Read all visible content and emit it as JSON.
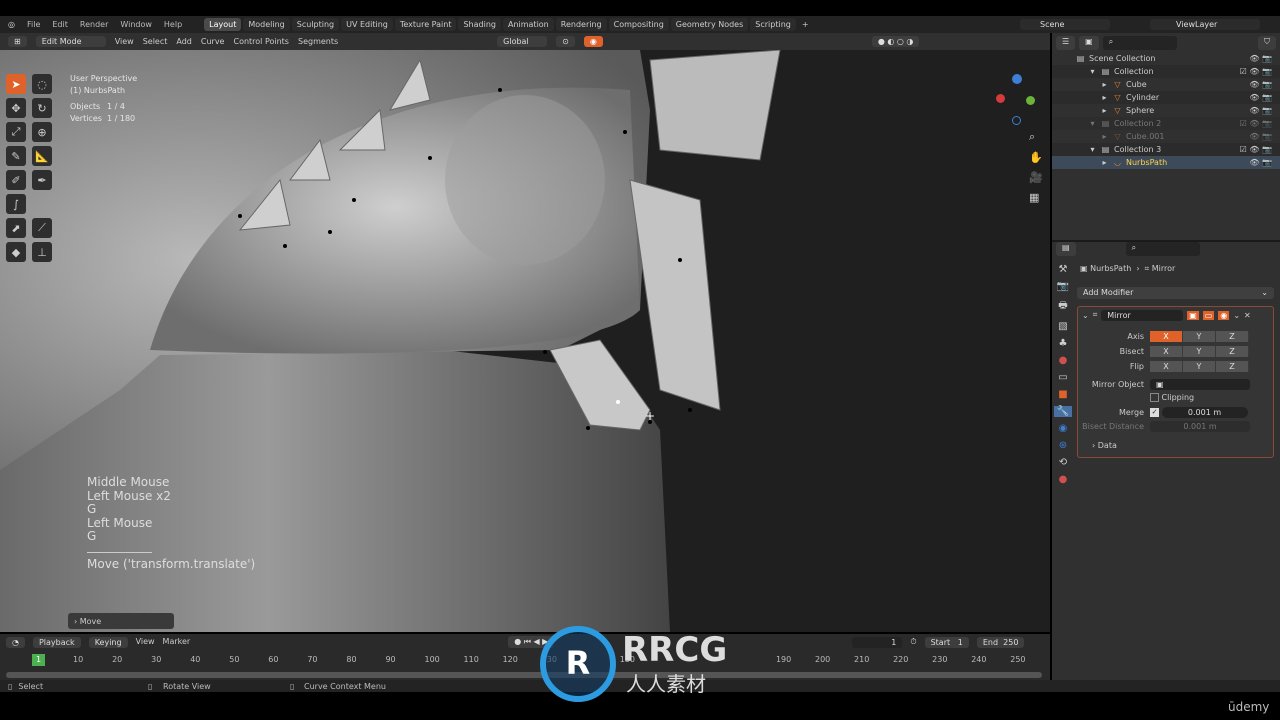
{
  "menu": [
    "File",
    "Edit",
    "Render",
    "Window",
    "Help"
  ],
  "workspaces": [
    "Layout",
    "Modeling",
    "Sculpting",
    "UV Editing",
    "Texture Paint",
    "Shading",
    "Animation",
    "Rendering",
    "Compositing",
    "Geometry Nodes",
    "Scripting"
  ],
  "active_workspace": "Layout",
  "scene": "Scene",
  "view_layer": "ViewLayer",
  "header": {
    "mode": "Edit Mode",
    "menus": [
      "View",
      "Select",
      "Add",
      "Curve",
      "Control Points",
      "Segments"
    ],
    "orientation": "Global"
  },
  "viewport": {
    "view_name": "User Perspective",
    "object_name": "(1) NurbsPath",
    "objects_label": "Objects",
    "objects_value": "1 / 4",
    "vertices_label": "Vertices",
    "vertices_value": "1 / 180",
    "log": [
      "Middle Mouse",
      "Left Mouse x2",
      "G",
      "Left Mouse",
      "G"
    ],
    "last_op": "Move ('transform.translate')",
    "redo_panel": "Move"
  },
  "outliner": {
    "items": [
      {
        "label": "Scene Collection",
        "depth": 0,
        "type": "collection"
      },
      {
        "label": "Collection",
        "depth": 1,
        "type": "collection"
      },
      {
        "label": "Cube",
        "depth": 2,
        "type": "mesh"
      },
      {
        "label": "Cylinder",
        "depth": 2,
        "type": "mesh"
      },
      {
        "label": "Sphere",
        "depth": 2,
        "type": "mesh"
      },
      {
        "label": "Collection 2",
        "depth": 1,
        "type": "collection",
        "disabled": true
      },
      {
        "label": "Cube.001",
        "depth": 2,
        "type": "mesh",
        "disabled": true
      },
      {
        "label": "Collection 3",
        "depth": 1,
        "type": "collection"
      },
      {
        "label": "NurbsPath",
        "depth": 2,
        "type": "curve",
        "active": true
      }
    ]
  },
  "properties": {
    "breadcrumb_object": "NurbsPath",
    "breadcrumb_modifier": "Mirror",
    "add_modifier": "Add Modifier",
    "modifier_name": "Mirror",
    "axis_label": "Axis",
    "bisect_label": "Bisect",
    "flip_label": "Flip",
    "axes": [
      "X",
      "Y",
      "Z"
    ],
    "axis_active": "X",
    "mirror_object_label": "Mirror Object",
    "clipping_label": "Clipping",
    "clipping": false,
    "merge_label": "Merge",
    "merge": true,
    "merge_value": "0.001 m",
    "bisect_distance_label": "Bisect Distance",
    "bisect_distance_value": "0.001 m",
    "data_label": "Data"
  },
  "timeline": {
    "menus": [
      "Playback",
      "Keying",
      "View",
      "Marker"
    ],
    "current_frame": "1",
    "start_label": "Start",
    "start": "1",
    "end_label": "End",
    "end": "250",
    "ticks": [
      "10",
      "20",
      "30",
      "40",
      "50",
      "60",
      "70",
      "80",
      "90",
      "100",
      "110",
      "120",
      "130",
      "150",
      "190",
      "200",
      "210",
      "220",
      "230",
      "240",
      "250"
    ]
  },
  "status": {
    "left": "Select",
    "middle": "Rotate View",
    "right": "Curve Context Menu"
  },
  "watermark": {
    "brand": "RRCG",
    "sub": "人人素材"
  },
  "udemy": "ūdemy",
  "colors": {
    "accent": "#e0622b",
    "active_item": "#ffd34a",
    "frame": "#4caf50"
  }
}
